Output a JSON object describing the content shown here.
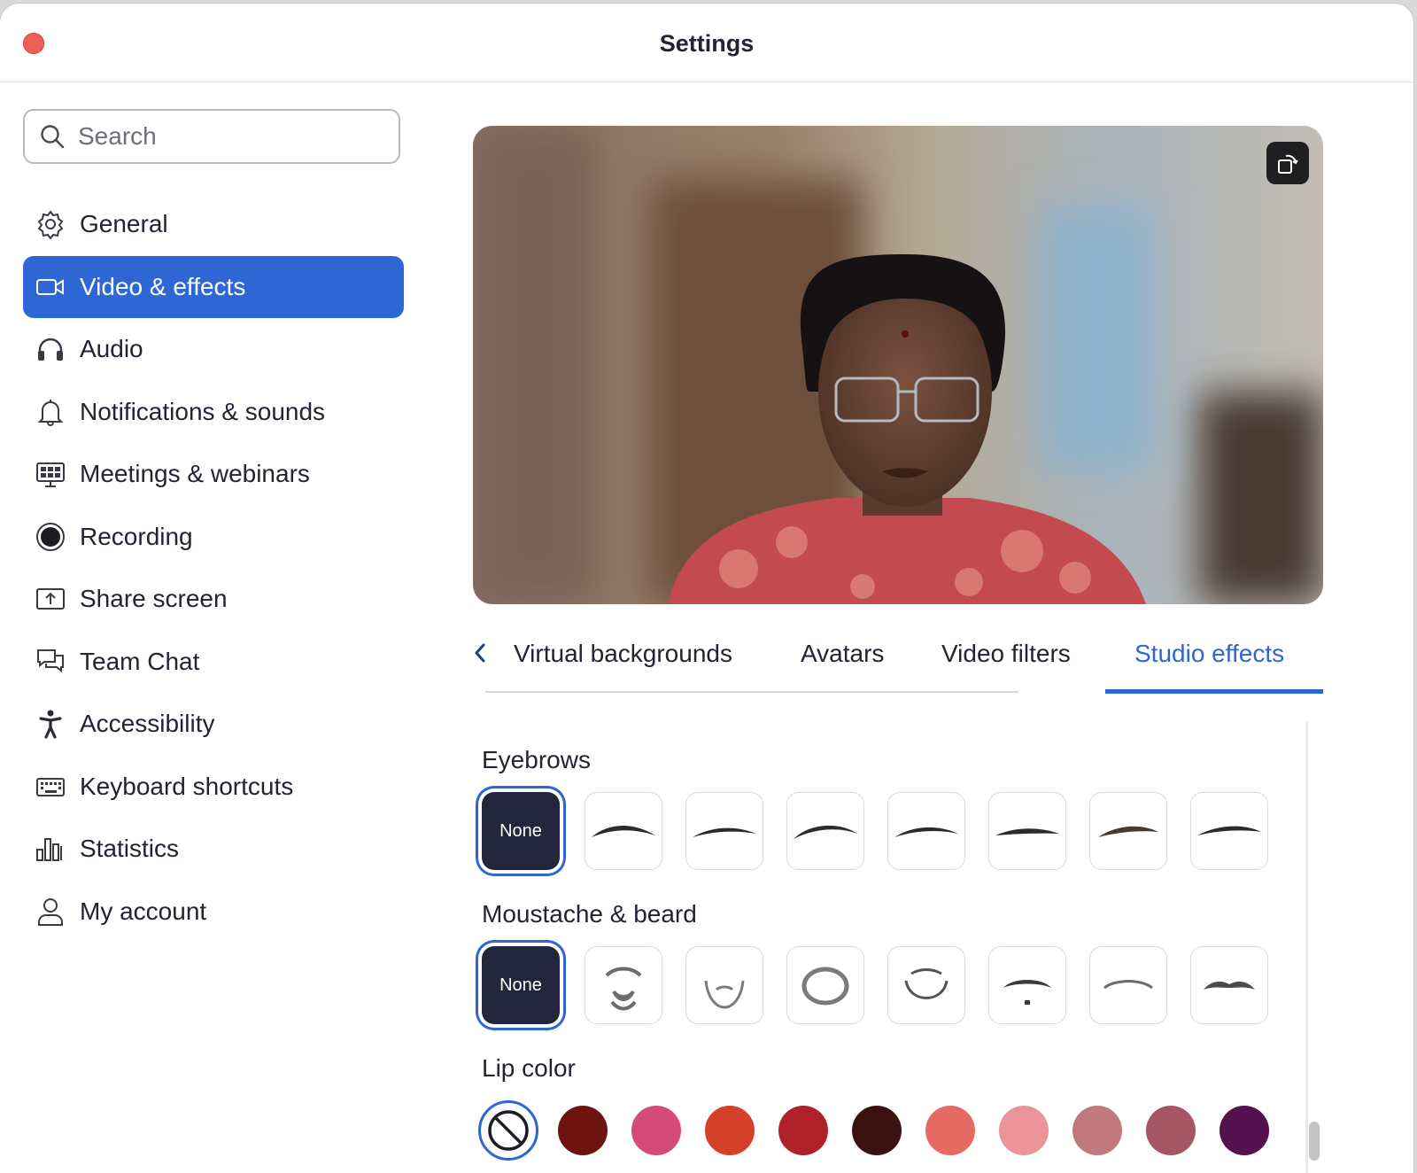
{
  "window": {
    "title": "Settings"
  },
  "search": {
    "placeholder": "Search"
  },
  "sidebar": {
    "items": [
      {
        "label": "General",
        "icon": "gear-icon",
        "active": false
      },
      {
        "label": "Video & effects",
        "icon": "video-camera-icon",
        "active": true
      },
      {
        "label": "Audio",
        "icon": "headphones-icon",
        "active": false
      },
      {
        "label": "Notifications & sounds",
        "icon": "bell-icon",
        "active": false
      },
      {
        "label": "Meetings & webinars",
        "icon": "meetings-icon",
        "active": false
      },
      {
        "label": "Recording",
        "icon": "record-icon",
        "active": false
      },
      {
        "label": "Share screen",
        "icon": "share-screen-icon",
        "active": false
      },
      {
        "label": "Team Chat",
        "icon": "chat-icon",
        "active": false
      },
      {
        "label": "Accessibility",
        "icon": "accessibility-icon",
        "active": false
      },
      {
        "label": "Keyboard shortcuts",
        "icon": "keyboard-icon",
        "active": false
      },
      {
        "label": "Statistics",
        "icon": "statistics-icon",
        "active": false
      },
      {
        "label": "My account",
        "icon": "user-icon",
        "active": false
      }
    ]
  },
  "tabs": {
    "items": [
      "Virtual backgrounds",
      "Avatars",
      "Video filters",
      "Studio effects"
    ],
    "active": "Studio effects"
  },
  "studio": {
    "eyebrows": {
      "title": "Eyebrows",
      "none_label": "None"
    },
    "beard": {
      "title": "Moustache & beard",
      "none_label": "None"
    },
    "lips": {
      "title": "Lip color",
      "colors": [
        "#6e1410",
        "#d54a78",
        "#d5402a",
        "#b0222b",
        "#3c1210",
        "#e56a62",
        "#ea9398",
        "#c07a7e",
        "#a65663",
        "#55104e"
      ]
    }
  },
  "colors": {
    "accent": "#2f66d6",
    "close": "#ee5f57"
  }
}
